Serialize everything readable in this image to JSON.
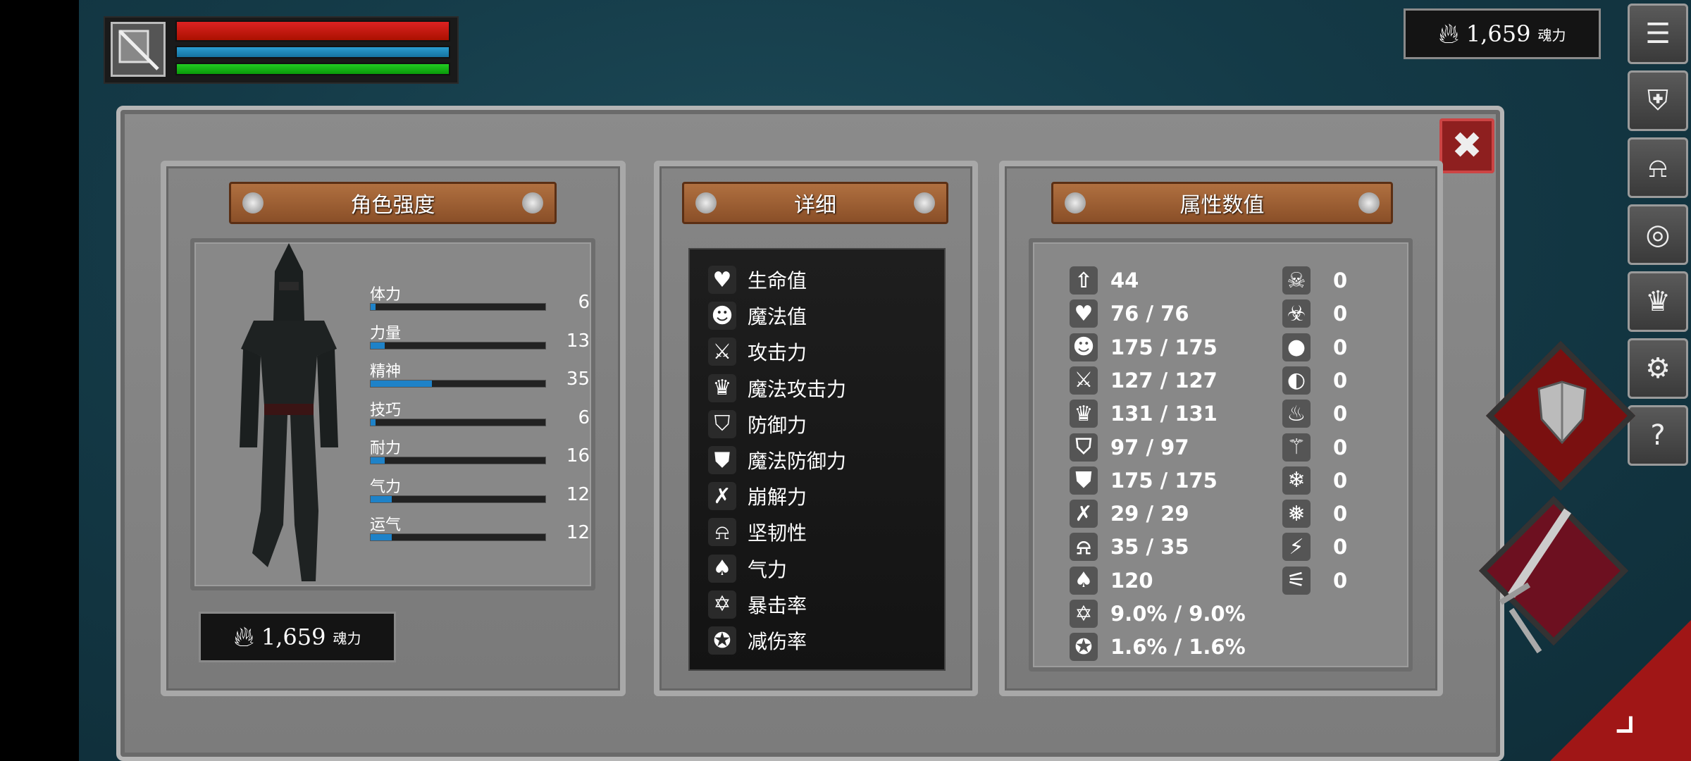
{
  "hud": {
    "weapon_icon": "sword-shield-icon",
    "colors": {
      "hp": "#d22222",
      "mp": "#2a9cd0",
      "stamina": "#22cc22"
    }
  },
  "currency": {
    "amount": "1,659",
    "unit": "魂力",
    "icon": "flame-icon"
  },
  "menu": [
    {
      "name": "menu-list-button",
      "icon": "list-icon",
      "glyph": "☰"
    },
    {
      "name": "menu-equipment-button",
      "icon": "armor-icon",
      "glyph": "⛨"
    },
    {
      "name": "menu-helmet-button",
      "icon": "helmet-icon",
      "glyph": "⍾"
    },
    {
      "name": "menu-soul-button",
      "icon": "soul-orb-icon",
      "glyph": "◎"
    },
    {
      "name": "menu-crown-button",
      "icon": "crown-icon",
      "glyph": "♛"
    },
    {
      "name": "menu-settings-button",
      "icon": "gear-icon",
      "glyph": "⚙"
    },
    {
      "name": "menu-help-button",
      "icon": "question-icon",
      "glyph": "?"
    }
  ],
  "panels": {
    "character": {
      "title": "角色强度"
    },
    "details": {
      "title": "详细"
    },
    "attributes": {
      "title": "属性数值"
    }
  },
  "stats": [
    {
      "label": "体力",
      "value": "6",
      "fill": 0.03
    },
    {
      "label": "力量",
      "value": "13",
      "fill": 0.08
    },
    {
      "label": "精神",
      "value": "35",
      "fill": 0.35
    },
    {
      "label": "技巧",
      "value": "6",
      "fill": 0.03
    },
    {
      "label": "耐力",
      "value": "16",
      "fill": 0.08
    },
    {
      "label": "气力",
      "value": "12",
      "fill": 0.12
    },
    {
      "label": "运气",
      "value": "12",
      "fill": 0.12
    }
  ],
  "details": [
    {
      "label": "生命值",
      "icon": "heart-icon",
      "glyph": "♥"
    },
    {
      "label": "魔法值",
      "icon": "head-icon",
      "glyph": "☻"
    },
    {
      "label": "攻击力",
      "icon": "sword-icon",
      "glyph": "⚔"
    },
    {
      "label": "魔法攻击力",
      "icon": "magic-crown-icon",
      "glyph": "♛"
    },
    {
      "label": "防御力",
      "icon": "shield-icon",
      "glyph": "⛉"
    },
    {
      "label": "魔法防御力",
      "icon": "magic-shield-icon",
      "glyph": "⛊"
    },
    {
      "label": "崩解力",
      "icon": "break-icon",
      "glyph": "✗"
    },
    {
      "label": "坚韧性",
      "icon": "helmet-icon",
      "glyph": "⍾"
    },
    {
      "label": "气力",
      "icon": "lungs-icon",
      "glyph": "♠"
    },
    {
      "label": "暴击率",
      "icon": "star-burst-icon",
      "glyph": "✡"
    },
    {
      "label": "减伤率",
      "icon": "shield-star-icon",
      "glyph": "✪"
    }
  ],
  "attributes_left": [
    {
      "icon": "level-icon",
      "glyph": "⇧",
      "value": "44"
    },
    {
      "icon": "heart-icon",
      "glyph": "♥",
      "value": "76 / 76"
    },
    {
      "icon": "head-icon",
      "glyph": "☻",
      "value": "175 / 175"
    },
    {
      "icon": "sword-icon",
      "glyph": "⚔",
      "value": "127 / 127"
    },
    {
      "icon": "magic-crown-icon",
      "glyph": "♛",
      "value": "131 / 131"
    },
    {
      "icon": "shield-icon",
      "glyph": "⛉",
      "value": "97 / 97"
    },
    {
      "icon": "magic-shield-icon",
      "glyph": "⛊",
      "value": "175 / 175"
    },
    {
      "icon": "break-icon",
      "glyph": "✗",
      "value": "29 / 29"
    },
    {
      "icon": "helmet-icon",
      "glyph": "⍾",
      "value": "35 / 35"
    },
    {
      "icon": "lungs-icon",
      "glyph": "♠",
      "value": "120"
    },
    {
      "icon": "star-burst-icon",
      "glyph": "✡",
      "value": "9.0% / 9.0%"
    },
    {
      "icon": "shield-star-icon",
      "glyph": "✪",
      "value": "1.6% / 1.6%"
    }
  ],
  "attributes_right": [
    {
      "icon": "skull-icon",
      "glyph": "☠",
      "value": "0"
    },
    {
      "icon": "poison-icon",
      "glyph": "☣",
      "value": "0"
    },
    {
      "icon": "blood-drop-icon",
      "glyph": "●",
      "value": "0"
    },
    {
      "icon": "blood-resist-icon",
      "glyph": "◐",
      "value": "0"
    },
    {
      "icon": "fire-icon",
      "glyph": "♨",
      "value": "0"
    },
    {
      "icon": "fire-resist-icon",
      "glyph": "⚚",
      "value": "0"
    },
    {
      "icon": "frost-icon",
      "glyph": "❄",
      "value": "0"
    },
    {
      "icon": "frost-resist-icon",
      "glyph": "❅",
      "value": "0"
    },
    {
      "icon": "lightning-icon",
      "glyph": "⚡",
      "value": "0"
    },
    {
      "icon": "lightning-resist-icon",
      "glyph": "⚟",
      "value": "0"
    }
  ],
  "actions": {
    "shield": "shield-icon",
    "attack": "sword-icon",
    "close": "close-icon",
    "collapse": "collapse-icon",
    "close_glyph": "✖",
    "collapse_glyph": "⌟"
  }
}
